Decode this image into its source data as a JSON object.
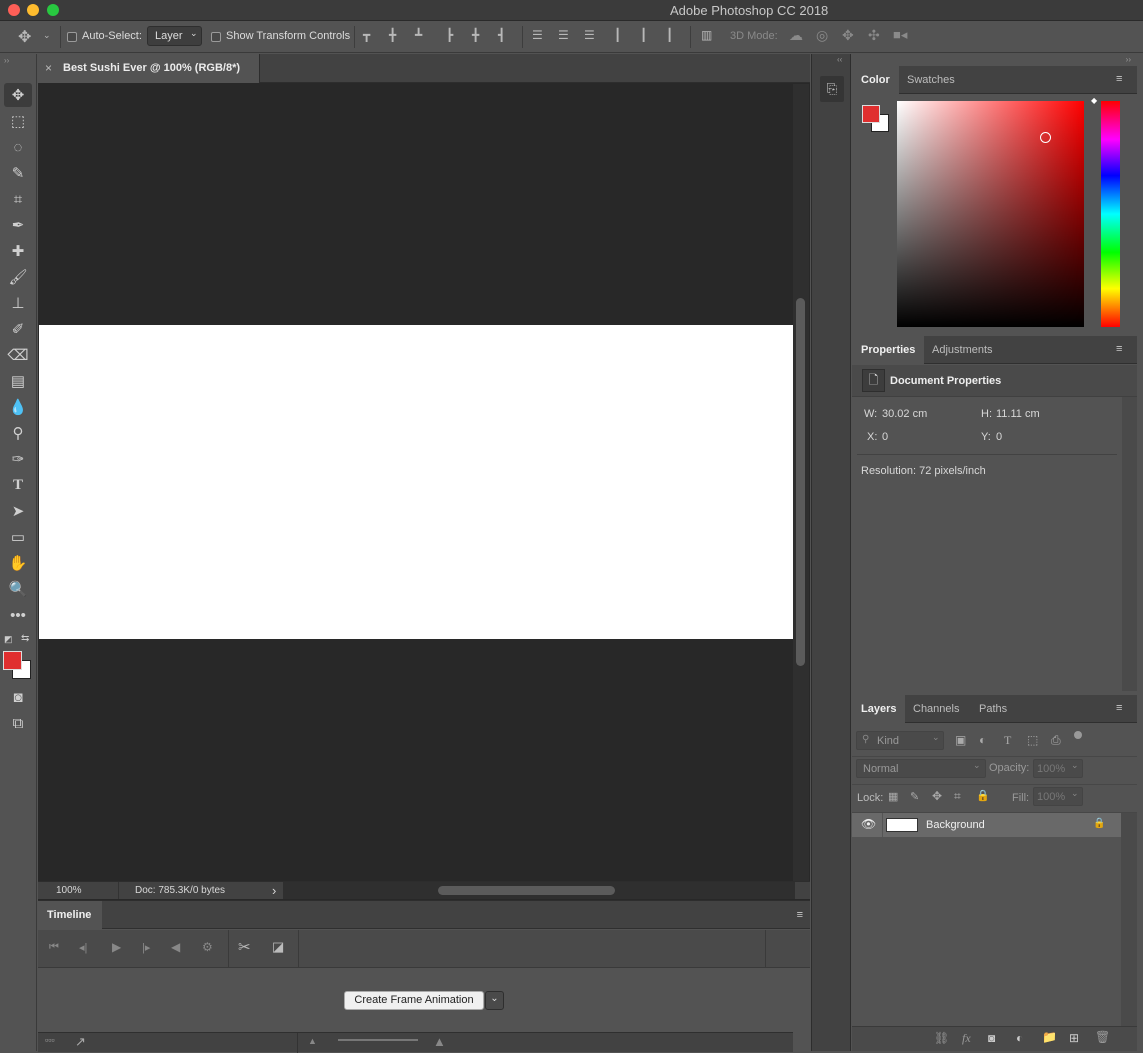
{
  "app": {
    "title": "Adobe Photoshop CC 2018"
  },
  "colors": {
    "foreground": "#e02f2f",
    "background": "#ffffff",
    "close": "#fe5f57",
    "minimize": "#febc2e",
    "zoom": "#28c840",
    "accent": "#e02f2f"
  },
  "options_bar": {
    "auto_select_label": "Auto-Select:",
    "auto_select_value": "Layer",
    "show_transform_label": "Show Transform Controls",
    "mode_3d_label": "3D Mode:"
  },
  "document": {
    "tab_title": "Best Sushi Ever @ 100% (RGB/8*)",
    "close_glyph": "×",
    "zoom": "100%",
    "doc_info": "Doc: 785.3K/0 bytes",
    "info_arrow": "›"
  },
  "timeline": {
    "title": "Timeline",
    "create_button": "Create Frame Animation"
  },
  "color_panel": {
    "tabs": [
      "Color",
      "Swatches"
    ],
    "active_tab": "Color"
  },
  "properties_panel": {
    "tabs": [
      "Properties",
      "Adjustments"
    ],
    "active_tab": "Properties",
    "header": "Document Properties",
    "w_label": "W:",
    "w_value": "30.02 cm",
    "h_label": "H:",
    "h_value": "11.11 cm",
    "x_label": "X:",
    "x_value": "0",
    "y_label": "Y:",
    "y_value": "0",
    "resolution": "Resolution: 72 pixels/inch"
  },
  "layers_panel": {
    "tabs": [
      "Layers",
      "Channels",
      "Paths"
    ],
    "active_tab": "Layers",
    "filter_kind": "Kind",
    "blend_mode": "Normal",
    "opacity_label": "Opacity:",
    "opacity_value": "100%",
    "lock_label": "Lock:",
    "fill_label": "Fill:",
    "fill_value": "100%",
    "layers": [
      {
        "name": "Background",
        "visible": true,
        "locked": true
      }
    ]
  }
}
